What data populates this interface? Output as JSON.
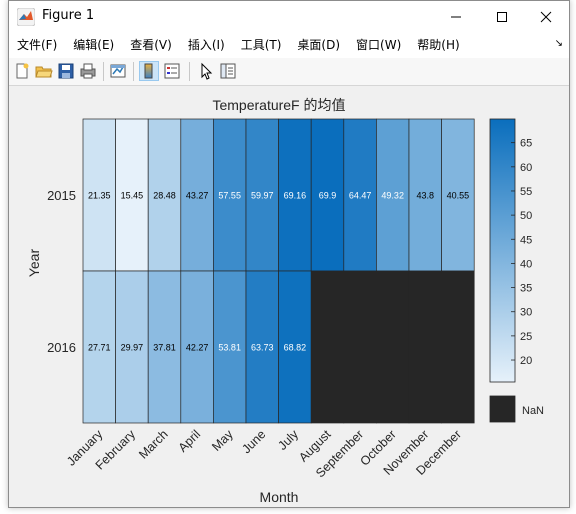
{
  "window": {
    "title": "Figure 1",
    "buttons": {
      "minimize": "—",
      "maximize": "☐",
      "close": "✕"
    }
  },
  "menu": {
    "items": [
      "文件(F)",
      "编辑(E)",
      "查看(V)",
      "插入(I)",
      "工具(T)",
      "桌面(D)",
      "窗口(W)",
      "帮助(H)"
    ]
  },
  "toolbar": {
    "icons": [
      "new-figure-icon",
      "open-file-icon",
      "save-icon",
      "print-icon",
      "link-plot-icon",
      "insert-colorbar-icon",
      "insert-legend-icon",
      "edit-plot-icon",
      "property-inspector-icon"
    ]
  },
  "chart_data": {
    "type": "heatmap",
    "title": "TemperatureF 的均值",
    "xlabel": "Month",
    "ylabel": "Year",
    "x": [
      "January",
      "February",
      "March",
      "April",
      "May",
      "June",
      "July",
      "August",
      "September",
      "October",
      "November",
      "December"
    ],
    "y": [
      "2015",
      "2016"
    ],
    "values": [
      [
        21.35,
        15.45,
        28.48,
        43.27,
        57.55,
        59.97,
        69.16,
        69.9,
        64.47,
        49.32,
        43.8,
        40.55
      ],
      [
        27.71,
        29.97,
        37.81,
        42.27,
        53.81,
        63.73,
        68.82,
        null,
        null,
        null,
        null,
        null
      ]
    ],
    "colorbar": {
      "min": 15.45,
      "max": 69.9,
      "ticks": [
        20,
        25,
        30,
        35,
        40,
        45,
        50,
        55,
        60,
        65
      ],
      "low_color": "#e6f1fa",
      "high_color": "#0a6ebd"
    },
    "missing_label": "NaN",
    "missing_color": "#262626"
  }
}
